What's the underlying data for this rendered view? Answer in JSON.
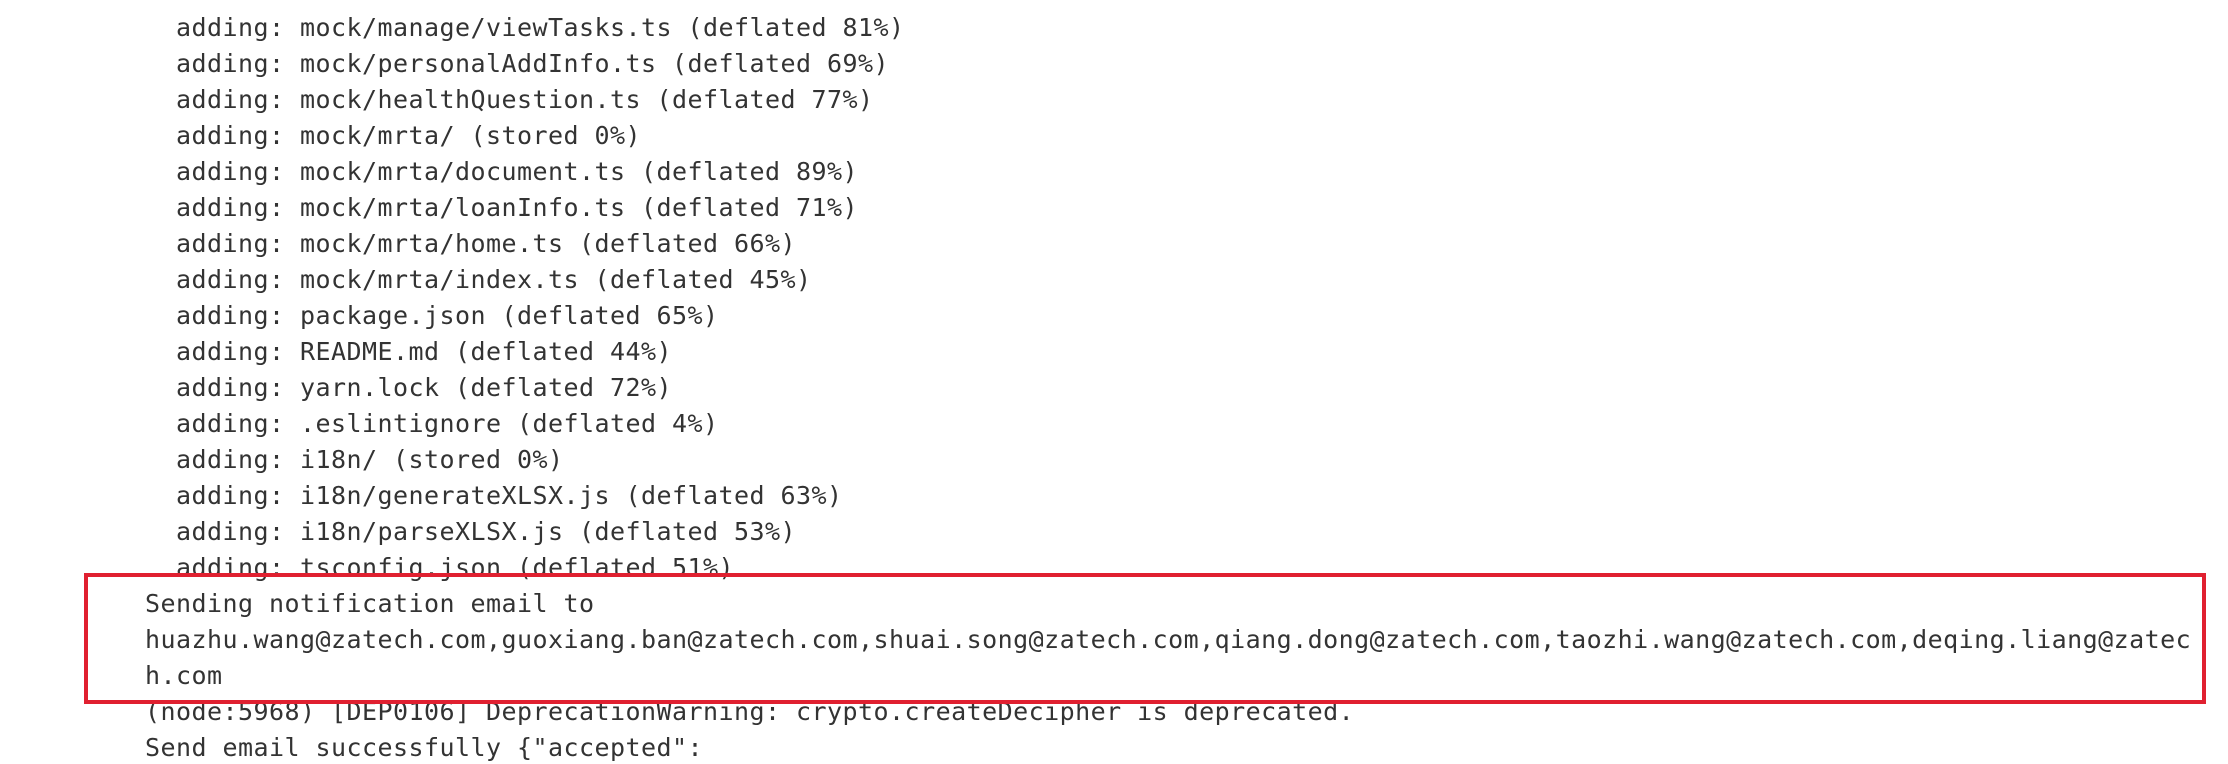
{
  "console": {
    "adding_lines": [
      "adding: mock/manage/viewTasks.ts (deflated 81%)",
      "adding: mock/personalAddInfo.ts (deflated 69%)",
      "adding: mock/healthQuestion.ts (deflated 77%)",
      "adding: mock/mrta/ (stored 0%)",
      "adding: mock/mrta/document.ts (deflated 89%)",
      "adding: mock/mrta/loanInfo.ts (deflated 71%)",
      "adding: mock/mrta/home.ts (deflated 66%)",
      "adding: mock/mrta/index.ts (deflated 45%)",
      "adding: package.json (deflated 65%)",
      "adding: README.md (deflated 44%)",
      "adding: yarn.lock (deflated 72%)",
      "adding: .eslintignore (deflated 4%)",
      "adding: i18n/ (stored 0%)",
      "adding: i18n/generateXLSX.js (deflated 63%)",
      "adding: i18n/parseXLSX.js (deflated 53%)",
      "adding: tsconfig.json (deflated 51%)"
    ],
    "notification_line": "Sending notification email to",
    "recipients_line_1": "huazhu.wang@zatech.com,guoxiang.ban@zatech.com,shuai.song@zatech.com,qiang.dong@zatech.com,taozhi.wang@zatech.com,deqing.liang@zatec",
    "recipients_line_2": "h.com",
    "deprecation_line": "(node:5968) [DEP0106] DeprecationWarning: crypto.createDecipher is deprecated.",
    "send_result_line": "Send email successfully {\"accepted\":"
  },
  "colors": {
    "text": "#333333",
    "highlight_border": "#e02030",
    "background": "#ffffff"
  }
}
